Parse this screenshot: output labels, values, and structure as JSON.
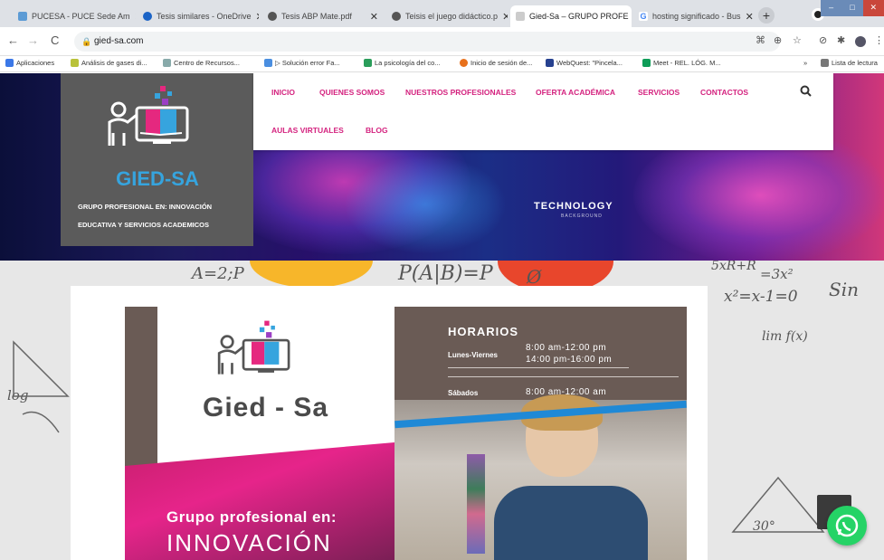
{
  "browser": {
    "tabs": [
      {
        "title": "PUCESA - PUCE Sede Am",
        "icon": "puce-favicon"
      },
      {
        "title": "Tesis similares - OneDrive",
        "icon": "onedrive-favicon"
      },
      {
        "title": "Tesis ABP Mate.pdf",
        "icon": "globe-favicon"
      },
      {
        "title": "Teisis el juego didáctico.p",
        "icon": "globe-favicon"
      },
      {
        "title": "Gied-Sa – GRUPO PROFE",
        "icon": "gied-favicon"
      },
      {
        "title": "hosting significado - Bus",
        "icon": "google-favicon"
      }
    ],
    "active_tab": 4,
    "url": "gied-sa.com",
    "bookmarks": [
      "Aplicaciones",
      "Análisis de gases di...",
      "Centro de Recursos...",
      "▷ Solución error Fa...",
      "La psicología del co...",
      "Inicio de sesión de...",
      "WebQuest: \"Pincela...",
      "Meet - REL. LÓG. M...",
      "Lista de lectura"
    ],
    "more": "»",
    "colors": {
      "tabbar": "#dee1e6",
      "close_red": "#c9473b"
    }
  },
  "site": {
    "brand": "GIED-SA",
    "tagline_1": "GRUPO PROFESIONAL EN: INNOVACIÓN",
    "tagline_2": "EDUCATIVA Y SERVICIOS ACADEMICOS",
    "nav": [
      "INICIO",
      "QUIENES SOMOS",
      "NUESTROS PROFESIONALES",
      "OFERTA ACADÉMICA",
      "SERVICIOS",
      "CONTACTOS",
      "AULAS VIRTUALES",
      "BLOG"
    ],
    "hero_text": "TECHNOLOGY",
    "hero_subtext": "BACKGROUND",
    "colors": {
      "nav_pink": "#d4237f",
      "brand_blue": "#36a4de",
      "logo_bg": "#5b5b5b"
    },
    "flyer": {
      "title": "Gied - Sa",
      "horarios_title": "HORARIOS",
      "row1_label": "Lunes-Viernes",
      "row1_val1": "8:00 am-12:00 pm",
      "row1_val2": "14:00 pm-16:00 pm",
      "row2_label": "Sábados",
      "row2_val": "8:00 am-12:00 am",
      "subtitle": "Grupo profesional en:",
      "headline": "INNOVACIÓN"
    },
    "scribbles": [
      "A=2;P",
      "P(A|B)=P",
      "x²=x-1=0",
      "Sin",
      "lim f(x)",
      "30°",
      "=3x²",
      "5xR+R",
      "Ø",
      "log"
    ]
  }
}
